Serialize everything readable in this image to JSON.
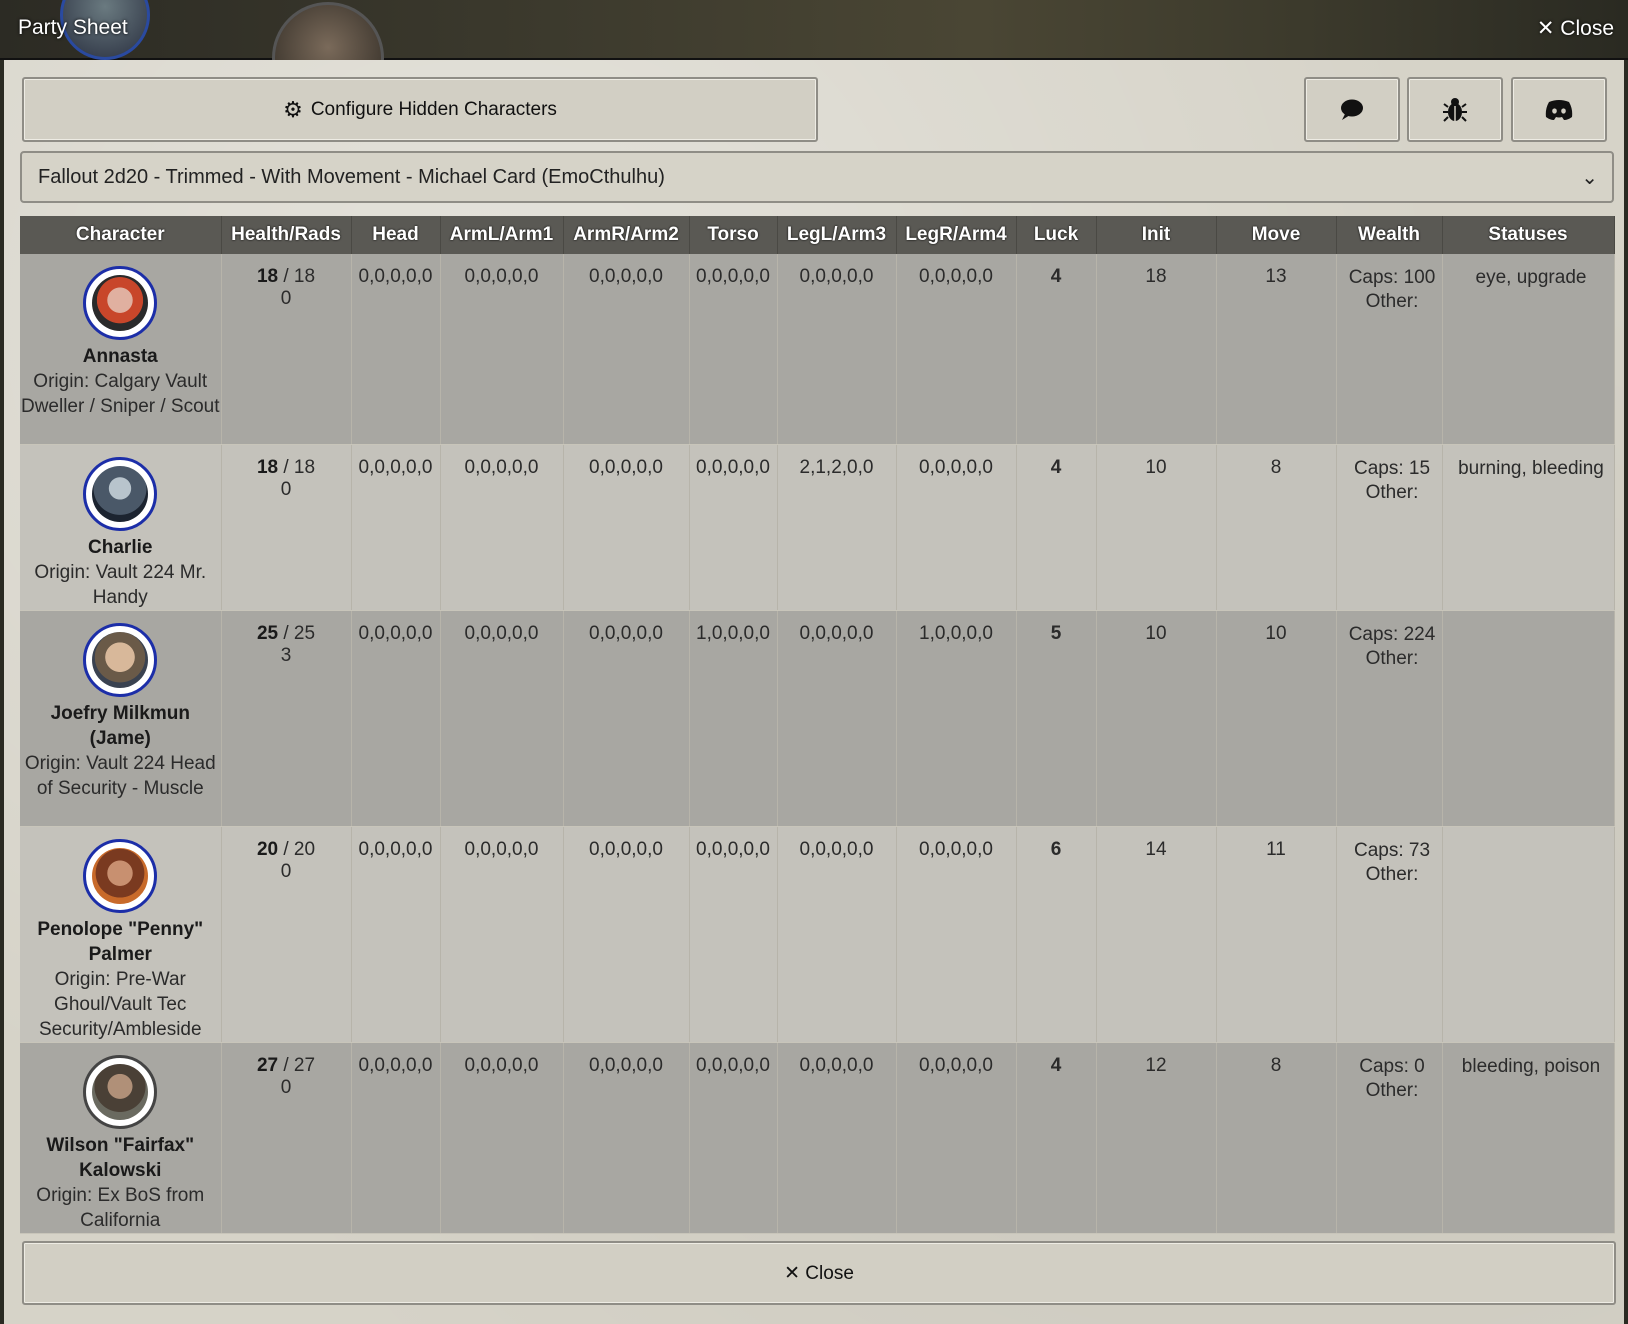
{
  "window": {
    "title": "Party Sheet",
    "close_label": "✕ Close"
  },
  "toolbar": {
    "config_label": "Configure Hidden Characters",
    "icons": [
      "gear-icon",
      "chat-icon",
      "bug-icon",
      "discord-icon"
    ]
  },
  "selector": {
    "value": "Fallout 2d20 - Trimmed - With Movement - Michael Card (EmoCthulhu)"
  },
  "table": {
    "headers": [
      "Character",
      "Health/Rads",
      "Head",
      "ArmL/Arm1",
      "ArmR/Arm2",
      "Torso",
      "LegL/Arm3",
      "LegR/Arm4",
      "Luck",
      "Init",
      "Move",
      "Wealth",
      "Statuses"
    ],
    "rows": [
      {
        "name": "Annasta",
        "origin": "Origin: Calgary Vault Dweller / Sniper / Scout",
        "hp_current": "18",
        "hp_max": " / 18",
        "rads": "0",
        "head": "0,0,0,0,0",
        "arml": "0,0,0,0,0",
        "armr": "0,0,0,0,0",
        "torso": "0,0,0,0,0",
        "legl": "0,0,0,0,0",
        "legr": "0,0,0,0,0",
        "luck": "4",
        "init": "18",
        "move": "13",
        "caps": "Caps: 100",
        "other": "Other:",
        "statuses": "eye, upgrade"
      },
      {
        "name": "Charlie",
        "origin": "Origin: Vault 224 Mr. Handy",
        "hp_current": "18",
        "hp_max": " / 18",
        "rads": "0",
        "head": "0,0,0,0,0",
        "arml": "0,0,0,0,0",
        "armr": "0,0,0,0,0",
        "torso": "0,0,0,0,0",
        "legl": "2,1,2,0,0",
        "legr": "0,0,0,0,0",
        "luck": "4",
        "init": "10",
        "move": "8",
        "caps": "Caps: 15",
        "other": "Other:",
        "statuses": "burning, bleeding"
      },
      {
        "name": "Joefry Milkmun (Jame)",
        "origin": "Origin: Vault 224 Head of Security - Muscle",
        "hp_current": "25",
        "hp_max": " / 25",
        "rads": "3",
        "head": "0,0,0,0,0",
        "arml": "0,0,0,0,0",
        "armr": "0,0,0,0,0",
        "torso": "1,0,0,0,0",
        "legl": "0,0,0,0,0",
        "legr": "1,0,0,0,0",
        "luck": "5",
        "init": "10",
        "move": "10",
        "caps": "Caps: 224",
        "other": "Other:",
        "statuses": ""
      },
      {
        "name": "Penolope \"Penny\" Palmer",
        "origin": "Origin: Pre-War Ghoul/Vault Tec Security/Ambleside",
        "hp_current": "20",
        "hp_max": " / 20",
        "rads": "0",
        "head": "0,0,0,0,0",
        "arml": "0,0,0,0,0",
        "armr": "0,0,0,0,0",
        "torso": "0,0,0,0,0",
        "legl": "0,0,0,0,0",
        "legr": "0,0,0,0,0",
        "luck": "6",
        "init": "14",
        "move": "11",
        "caps": "Caps: 73",
        "other": "Other:",
        "statuses": ""
      },
      {
        "name": "Wilson \"Fairfax\" Kalowski",
        "origin": "Origin: Ex BoS from California",
        "hp_current": "27",
        "hp_max": " / 27",
        "rads": "0",
        "head": "0,0,0,0,0",
        "arml": "0,0,0,0,0",
        "armr": "0,0,0,0,0",
        "torso": "0,0,0,0,0",
        "legl": "0,0,0,0,0",
        "legr": "0,0,0,0,0",
        "luck": "4",
        "init": "12",
        "move": "8",
        "caps": "Caps: 0",
        "other": "Other:",
        "statuses": "bleeding, poison"
      }
    ]
  },
  "footer": {
    "close_label": "✕ Close"
  }
}
